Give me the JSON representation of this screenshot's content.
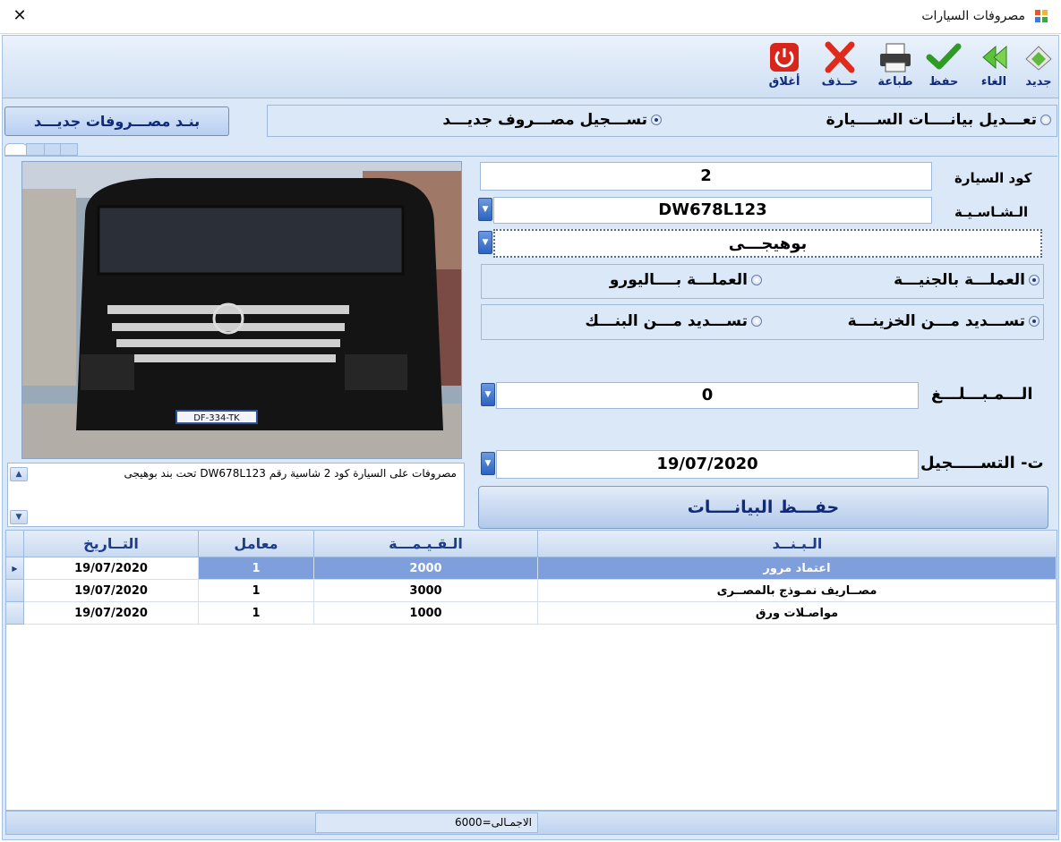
{
  "window": {
    "title": "مصروفات السيارات"
  },
  "toolbar": {
    "new_label": "جديد",
    "cancel_label": "الغاء",
    "save_label": "حفظ",
    "print_label": "طباعة",
    "delete_label": "حــذف",
    "close_label": "أغلاق"
  },
  "new_item_button": "بنـد مصـــروفات جديـــد",
  "mode": {
    "edit_car_label": "تعـــديل بيانــــات الســــيارة",
    "new_expense_label": "تســـجيل مصـــروف جديـــد",
    "selected": "new_expense"
  },
  "form": {
    "car_code_label": "كود السيارة",
    "car_code_value": "2",
    "chassis_label": "الـشـاسـيـة",
    "chassis_value": "DW678L123",
    "item_value": "بوهيجـــى",
    "currency_egp_label": "العملـــة بالجنيـــة",
    "currency_euro_label": "العملـــة بــــاليورو",
    "currency_selected": "egp",
    "pay_treasury_label": "تســـديد مـــن الخزينـــة",
    "pay_bank_label": "تســـديد مـــن البنـــك",
    "payment_selected": "treasury",
    "amount_label": "الـــمـبـــلـــغ",
    "amount_value": "0",
    "date_label": "ت- التســـــجيل",
    "date_value": "19/07/2020",
    "save_data_button": "حفـــظ البيانــــات"
  },
  "notes": "مصروفات على السيارة كود 2 شاسية رقم DW678L123 تحت بند بوهيجى",
  "grid": {
    "headers": {
      "item": "الـبـنــد",
      "value": "الـقـيـمـــة",
      "factor": "معامل",
      "date": "التــاريخ"
    },
    "rows": [
      {
        "item": "اعتماد مرور",
        "value": "2000",
        "factor": "1",
        "date": "19/07/2020",
        "selected": true
      },
      {
        "item": "مصــاريف نمـوذج بالمصــرى",
        "value": "3000",
        "factor": "1",
        "date": "19/07/2020",
        "selected": false
      },
      {
        "item": "مواصـلات ورق",
        "value": "1000",
        "factor": "1",
        "date": "19/07/2020",
        "selected": false
      }
    ]
  },
  "footer": {
    "total": "الاجمـالى=6000"
  },
  "photo": {
    "plate_text": "DF-334-TK"
  },
  "colors": {
    "frame": "#dbe8f8",
    "selected_row": "#7f9edc",
    "header_text": "#1d3c8a",
    "button_text": "#102a78"
  },
  "icons": [
    "close-x-icon",
    "app-icon",
    "new-doc-icon",
    "undo-arrows-icon",
    "checkmark-icon",
    "printer-icon",
    "delete-x-icon",
    "power-icon",
    "dropdown-arrow-icon"
  ]
}
